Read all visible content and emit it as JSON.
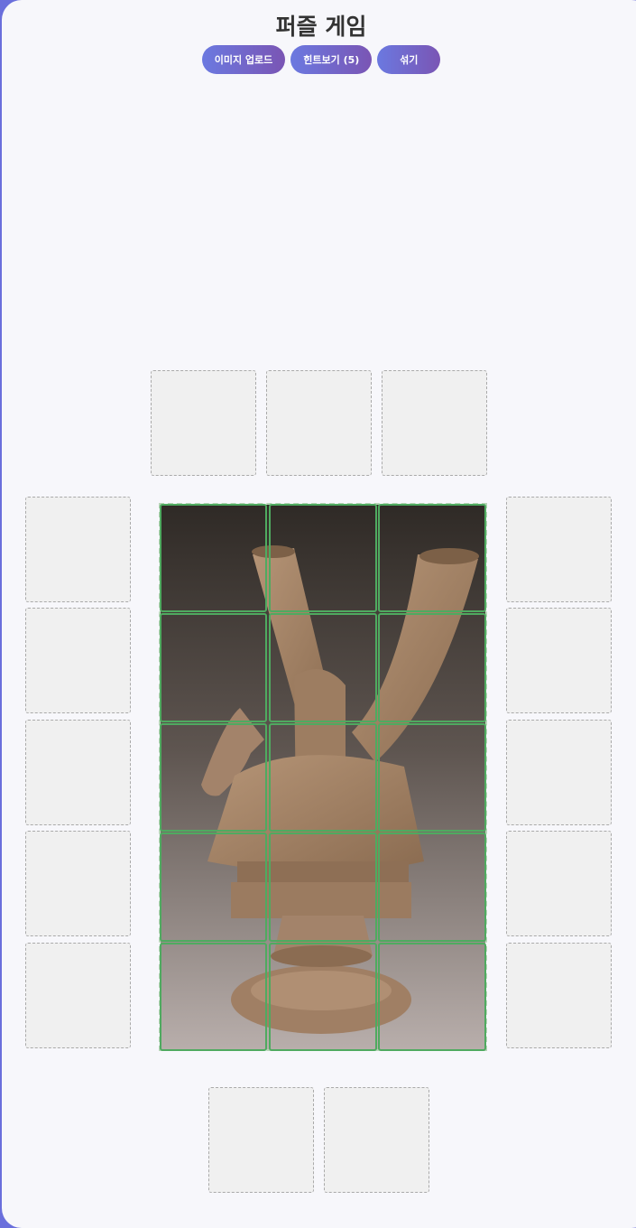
{
  "title": "퍼즐 게임",
  "buttons": {
    "upload": "이미지 업로드",
    "hint": "힌트보기 (5)",
    "shuffle": "섞기"
  },
  "board": {
    "rows": 5,
    "cols": 3,
    "placed_pieces": 15
  },
  "colors": {
    "accent_start": "#6b79e0",
    "accent_end": "#7a55b4",
    "piece_border": "#4faa60"
  }
}
